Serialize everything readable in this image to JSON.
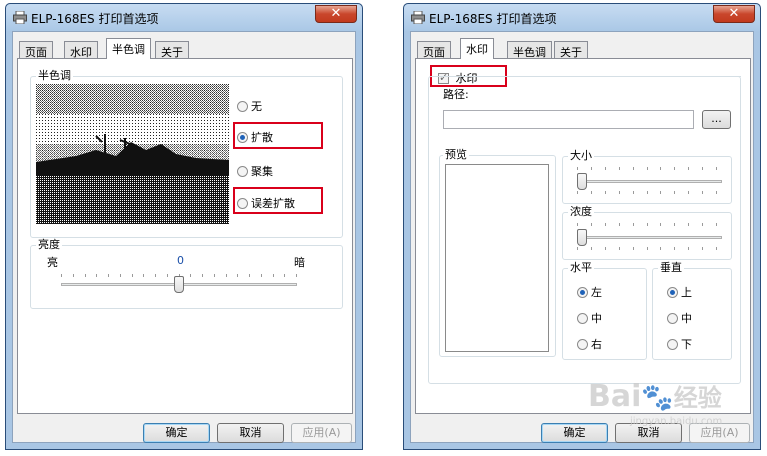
{
  "colors": {
    "highlight": "#d9001b",
    "accent": "#1f62b8",
    "title_bar": "#aac8e6"
  },
  "left_dialog": {
    "title": "ELP-168ES 打印首选项",
    "close_label": "✕",
    "tabs": [
      "页面",
      "水印",
      "半色调",
      "关于"
    ],
    "active_tab": "半色调",
    "halftone": {
      "group_label": "半色调",
      "options": [
        {
          "label": "无",
          "selected": false
        },
        {
          "label": "扩散",
          "selected": true
        },
        {
          "label": "聚集",
          "selected": false
        },
        {
          "label": "误差扩散",
          "selected": false
        }
      ]
    },
    "brightness": {
      "group_label": "亮度",
      "min_label": "亮",
      "max_label": "暗",
      "value": "0",
      "position": 0.5
    },
    "buttons": {
      "ok": "确定",
      "cancel": "取消",
      "apply": "应用(A)"
    }
  },
  "right_dialog": {
    "title": "ELP-168ES 打印首选项",
    "close_label": "✕",
    "tabs": [
      "页面",
      "水印",
      "半色调",
      "关于"
    ],
    "active_tab": "水印",
    "watermark": {
      "enable_label": "水印",
      "enabled": true,
      "path_label": "路径:",
      "path_value": "",
      "browse_label": "...",
      "preview_label": "预览",
      "size_label": "大小",
      "size_position": 0.0,
      "density_label": "浓度",
      "density_position": 0.0,
      "horizontal": {
        "group_label": "水平",
        "options": [
          {
            "label": "左",
            "selected": true
          },
          {
            "label": "中",
            "selected": false
          },
          {
            "label": "右",
            "selected": false
          }
        ]
      },
      "vertical": {
        "group_label": "垂直",
        "options": [
          {
            "label": "上",
            "selected": true
          },
          {
            "label": "中",
            "selected": false
          },
          {
            "label": "下",
            "selected": false
          }
        ]
      }
    },
    "buttons": {
      "ok": "确定",
      "cancel": "取消",
      "apply": "应用(A)"
    }
  },
  "site_watermark": {
    "logo_text": "Bai",
    "logo_cn": "经验",
    "url": "jingyan.baidu.com"
  }
}
